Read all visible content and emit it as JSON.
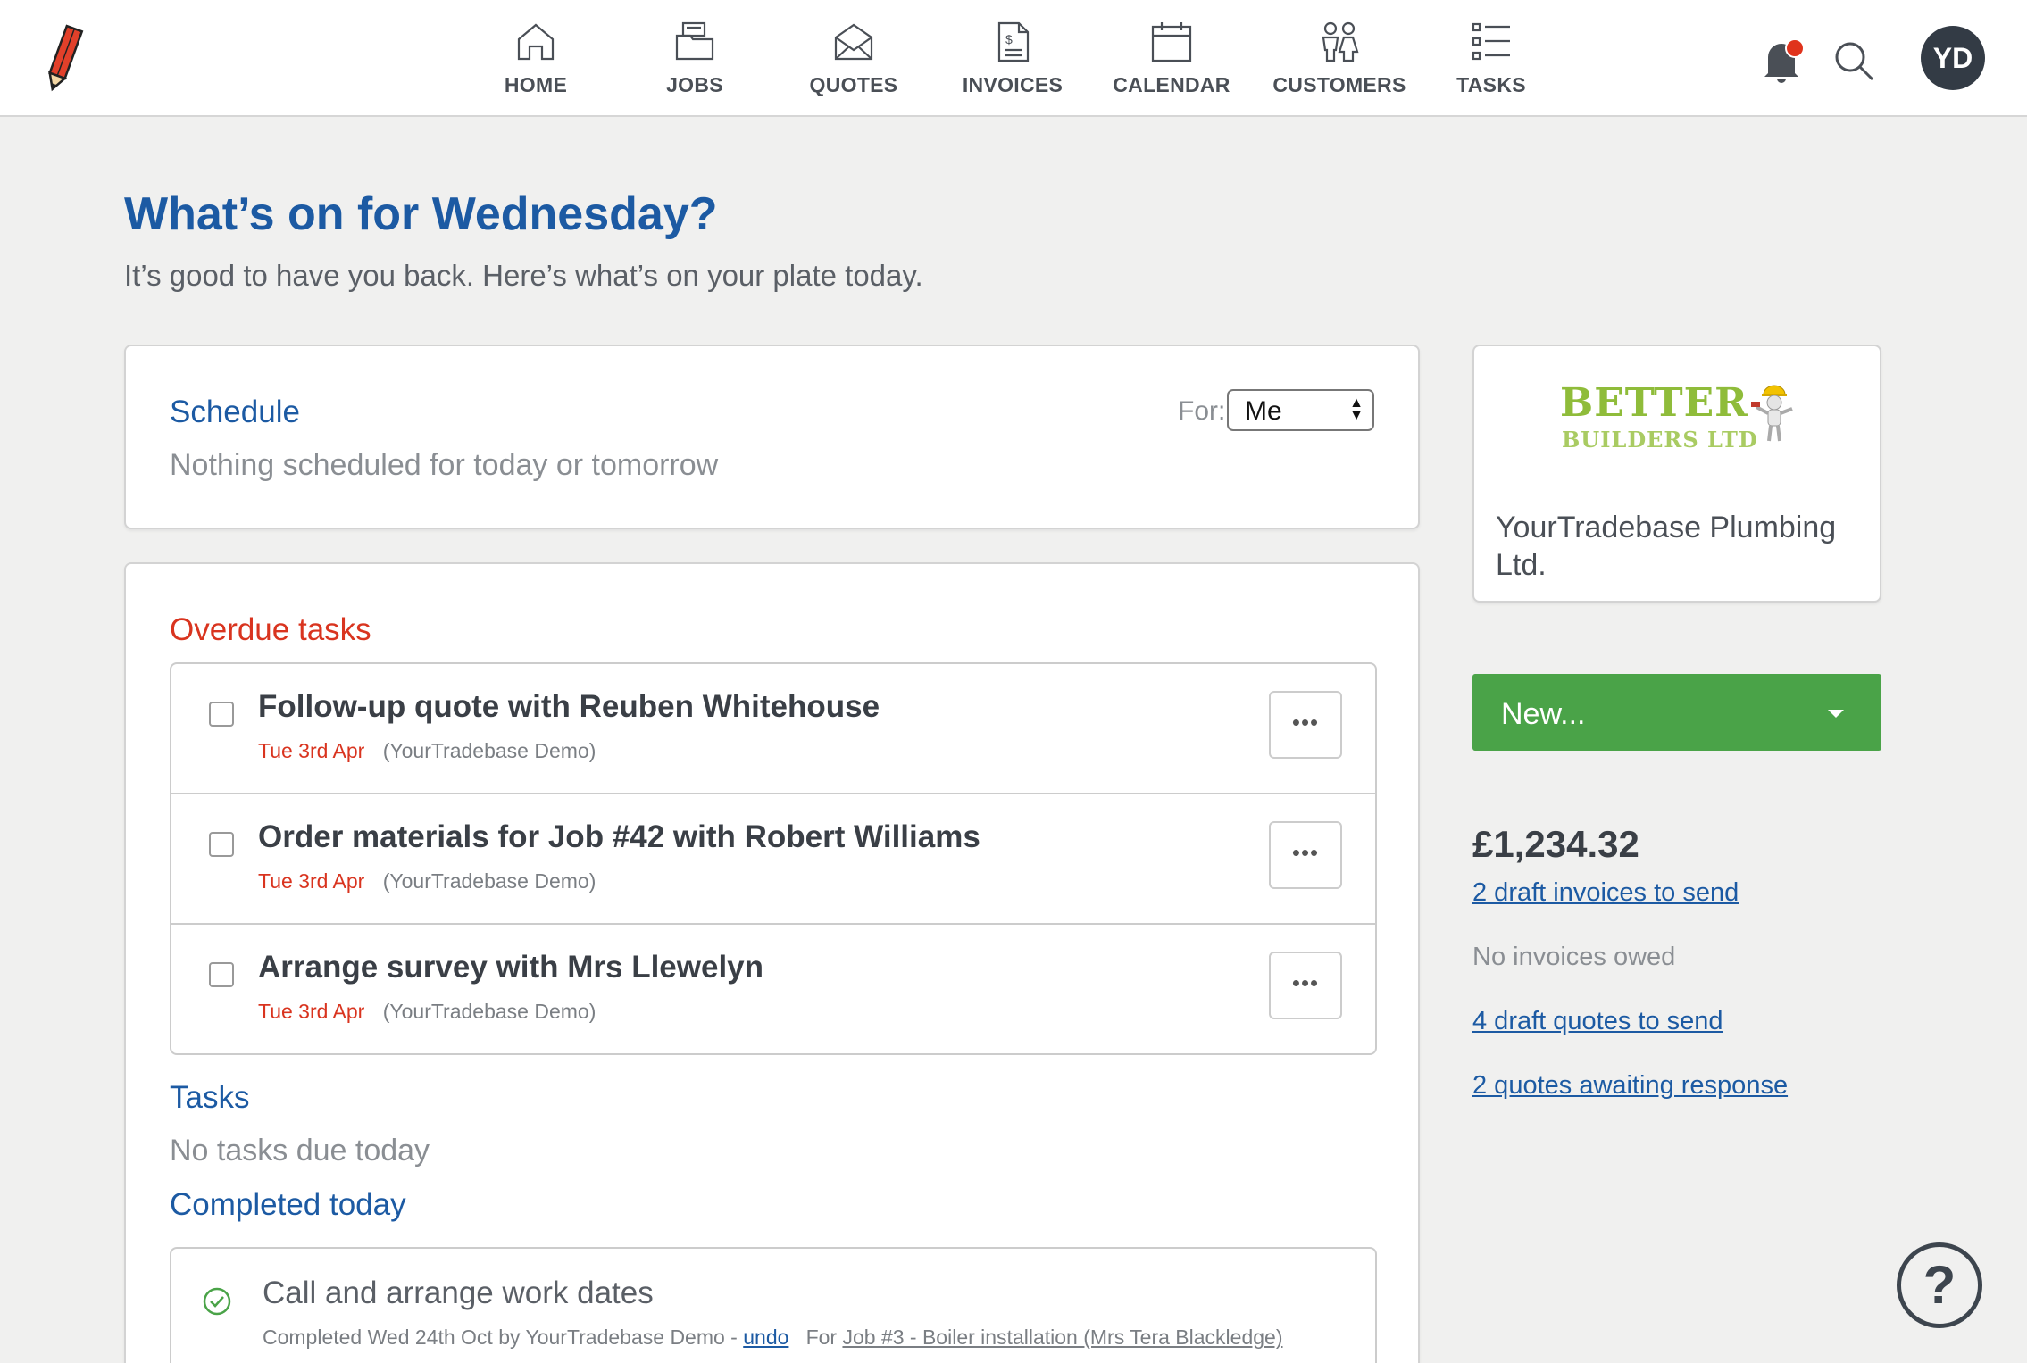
{
  "nav": {
    "items": [
      {
        "label": "HOME",
        "icon": "home-icon"
      },
      {
        "label": "JOBS",
        "icon": "jobs-icon"
      },
      {
        "label": "QUOTES",
        "icon": "quotes-icon"
      },
      {
        "label": "INVOICES",
        "icon": "invoices-icon"
      },
      {
        "label": "CALENDAR",
        "icon": "calendar-icon"
      },
      {
        "label": "CUSTOMERS",
        "icon": "customers-icon"
      },
      {
        "label": "TASKS",
        "icon": "tasks-icon"
      }
    ],
    "avatar_initials": "YD",
    "notification_dot_color": "#e0331c"
  },
  "header": {
    "title": "What’s on for Wednesday?",
    "subtitle": "It’s good to have you back. Here’s what’s on your plate today."
  },
  "schedule": {
    "title": "Schedule",
    "empty_text": "Nothing scheduled for today or tomorrow",
    "for_label": "For:",
    "for_value": "Me"
  },
  "overdue": {
    "title": "Overdue tasks",
    "items": [
      {
        "title": "Follow-up quote with Reuben Whitehouse",
        "date": "Tue 3rd Apr",
        "owner": "(YourTradebase Demo)"
      },
      {
        "title": "Order materials for Job #42 with Robert Williams",
        "date": "Tue 3rd Apr",
        "owner": "(YourTradebase Demo)"
      },
      {
        "title": "Arrange survey with Mrs Llewelyn",
        "date": "Tue 3rd Apr",
        "owner": "(YourTradebase Demo)"
      }
    ],
    "more_label": "•••"
  },
  "tasks": {
    "title": "Tasks",
    "empty_text": "No tasks due today"
  },
  "completed": {
    "title": "Completed today",
    "item": {
      "title": "Call and arrange work dates",
      "meta_prefix": "Completed Wed 24th Oct by YourTradebase Demo - ",
      "undo_label": "undo",
      "for_label": "For ",
      "job_link": "Job #3 - Boiler installation (Mrs Tera Blackledge)"
    }
  },
  "company": {
    "logo_line1": "BETTER",
    "logo_line2": "BUILDERS LTD",
    "name": "YourTradebase Plumbing Ltd."
  },
  "new_button": {
    "label": "New..."
  },
  "finance": {
    "amount": "£1,234.32",
    "draft_invoices": "2 draft invoices to send",
    "no_invoices": "No invoices owed",
    "draft_quotes": "4 draft quotes to send",
    "awaiting": "2 quotes awaiting response"
  },
  "help": {
    "label": "?"
  },
  "colors": {
    "brand_blue": "#1c5aa3",
    "overdue_red": "#d9341f",
    "new_green": "#4aa348"
  }
}
